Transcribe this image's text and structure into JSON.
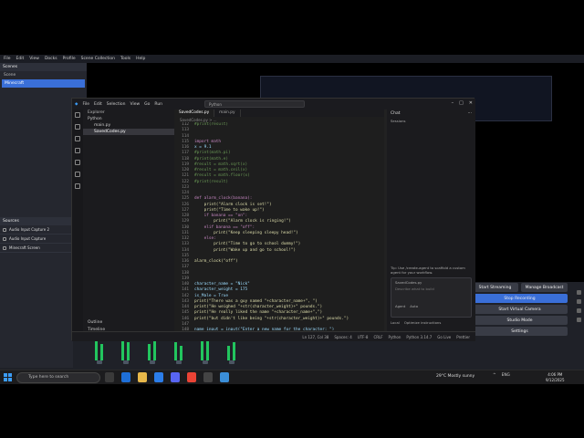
{
  "obs": {
    "menu": [
      "File",
      "Edit",
      "View",
      "Docks",
      "Profile",
      "Scene Collection",
      "Tools",
      "Help"
    ],
    "scenes_title": "Scenes",
    "scene_header": "Scene",
    "scene_active": "Minecraft",
    "sources_title": "Sources",
    "sources": [
      "Audio Input Capture 2",
      "Audio Input Capture",
      "Minecraft Screen"
    ],
    "controls": {
      "start_streaming": "Start Streaming",
      "manage_broadcast": "Manage Broadcast",
      "stop_recording": "Stop Recording",
      "virtual_camera": "Start Virtual Camera",
      "studio_mode": "Studio Mode",
      "settings": "Settings"
    },
    "bottom_label": "0 Problems"
  },
  "vscode": {
    "menu": [
      "File",
      "Edit",
      "Selection",
      "View",
      "Go",
      "Run"
    ],
    "search": "Python",
    "explorer": {
      "title": "Explorer",
      "folder": "Python",
      "files": [
        "main.py",
        "SavedCodes.py"
      ],
      "outline": "Outline",
      "timeline": "Timeline"
    },
    "tabs": [
      "SavedCodes.py",
      "main.py"
    ],
    "breadcrumb": "SavedCodes.py > ...",
    "chat": {
      "title": "Chat",
      "sessions": "Sessions",
      "hint": "Tip: Use /create-agent to scaffold a custom agent for your workflow.",
      "context": "SavedCodes.py",
      "placeholder": "Describe what to build",
      "agent": "Agent",
      "auto": "Auto",
      "local": "Local",
      "optimize": "Optimize instructions"
    },
    "status": [
      "Ln 127, Col 38",
      "Spaces: 4",
      "UTF-8",
      "CRLF",
      "Python",
      "Python 3.14.7",
      "Go Live",
      "Prettier"
    ],
    "code": [
      {
        "n": "112",
        "t": "#print(result)",
        "c": "cm"
      },
      {
        "n": "113",
        "t": "",
        "c": ""
      },
      {
        "n": "114",
        "t": "",
        "c": ""
      },
      {
        "n": "115",
        "t": "import math",
        "c": "kw"
      },
      {
        "n": "116",
        "t": "x = 9.1",
        "c": "vr"
      },
      {
        "n": "117",
        "t": "#print(math.pi)",
        "c": "cm"
      },
      {
        "n": "118",
        "t": "#print(math.e)",
        "c": "cm"
      },
      {
        "n": "119",
        "t": "#result = math.sqrt(x)",
        "c": "cm"
      },
      {
        "n": "120",
        "t": "#result = math.ceil(x)",
        "c": "cm"
      },
      {
        "n": "121",
        "t": "#result = math.floor(x)",
        "c": "cm"
      },
      {
        "n": "122",
        "t": "#print(result)",
        "c": "cm"
      },
      {
        "n": "123",
        "t": "",
        "c": ""
      },
      {
        "n": "124",
        "t": "",
        "c": ""
      },
      {
        "n": "125",
        "t": "def alarm_clock(banana):",
        "c": "kw"
      },
      {
        "n": "126",
        "t": "    print(\"Alarm clock is set!\")",
        "c": "fn"
      },
      {
        "n": "127",
        "t": "    print(\"Time to wake up!\")",
        "c": "fn"
      },
      {
        "n": "128",
        "t": "    if banana == \"on\":",
        "c": "kw"
      },
      {
        "n": "129",
        "t": "        print(\"Alarm clock is ringing!\")",
        "c": "fn"
      },
      {
        "n": "130",
        "t": "    elif banana == \"off\":",
        "c": "kw"
      },
      {
        "n": "131",
        "t": "        print(\"Keep sleeping sleepy head!\")",
        "c": "fn"
      },
      {
        "n": "132",
        "t": "    else:",
        "c": "kw"
      },
      {
        "n": "133",
        "t": "        print(\"Time to go to school dummy!\")",
        "c": "fn"
      },
      {
        "n": "134",
        "t": "        print(\"Wake up and go to school!\")",
        "c": "fn"
      },
      {
        "n": "135",
        "t": "",
        "c": ""
      },
      {
        "n": "136",
        "t": "alarm_clock(\"off\")",
        "c": "fn"
      },
      {
        "n": "137",
        "t": "",
        "c": ""
      },
      {
        "n": "138",
        "t": "",
        "c": ""
      },
      {
        "n": "139",
        "t": "",
        "c": ""
      },
      {
        "n": "140",
        "t": "character_name = \"Nick\"",
        "c": "vr"
      },
      {
        "n": "141",
        "t": "character_weight = 175",
        "c": "vr"
      },
      {
        "n": "142",
        "t": "is_Male = True",
        "c": "vr"
      },
      {
        "n": "143",
        "t": "print(\"There was a guy named \"+character_name+\", \")",
        "c": "fn"
      },
      {
        "n": "144",
        "t": "print(\"He weighed \"+str(character_weight)+\" pounds.\")",
        "c": "fn"
      },
      {
        "n": "145",
        "t": "print(\"He really liked the name \"+character_name+\",\")",
        "c": "fn"
      },
      {
        "n": "146",
        "t": "print(\"but didn't like being \"+str(character_weight)+\" pounds.\")",
        "c": "fn"
      },
      {
        "n": "147",
        "t": "",
        "c": ""
      },
      {
        "n": "148",
        "t": "name_input = input(\"Enter a new name for the character: \")",
        "c": "vr"
      }
    ]
  },
  "taskbar": {
    "search_placeholder": "Type here to search",
    "weather": "29°C  Mostly sunny",
    "language": "ENG",
    "time": "4:06 PM",
    "date": "9/12/2025"
  },
  "colors": {
    "accent": "#3a6fd8",
    "meter": "#22c55e"
  }
}
